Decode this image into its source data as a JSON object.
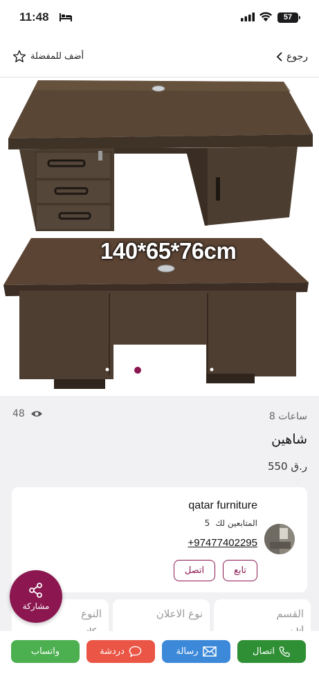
{
  "status_bar": {
    "time": "11:48",
    "battery": "57"
  },
  "nav": {
    "back_label": "رجوع",
    "favorite_label": "أضف للمفضلة"
  },
  "gallery": {
    "dimensions_text": "140*65*76cm"
  },
  "listing": {
    "posted": "8 ساعات",
    "views": "48",
    "title": "شاهين",
    "price": "550 ر.ق"
  },
  "seller": {
    "name": "qatar furniture",
    "followers_label": "المتابعين لك",
    "followers_count": "5",
    "phone": "+97477402295",
    "follow_label": "تابع",
    "call_label": "اتصل"
  },
  "details": [
    {
      "label": "القسم",
      "value": "أثاث"
    },
    {
      "label": "نوع الاعلان",
      "value": "بيع"
    },
    {
      "label": "النوع",
      "value": "مكاتب"
    }
  ],
  "share_label": "مشاركة",
  "actions": {
    "call": "اتصال",
    "message": "رسالة",
    "chat": "دردشة",
    "whatsapp": "واتساب"
  },
  "colors": {
    "brand": "#8b1650",
    "call": "#2f8f34",
    "message": "#3d89d9",
    "chat": "#ea5545",
    "whatsapp": "#4caf50"
  }
}
